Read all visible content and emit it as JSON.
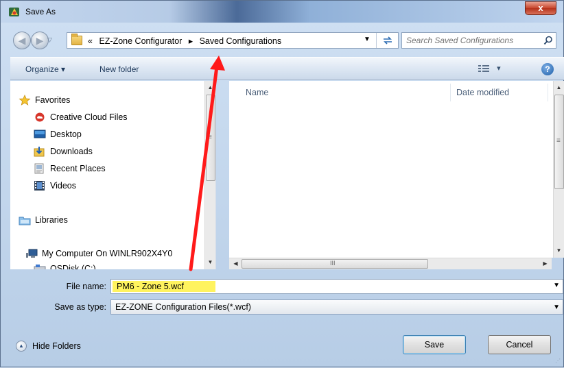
{
  "window": {
    "title": "Save As",
    "close_label": "x"
  },
  "nav": {
    "back_glyph": "◀",
    "forward_glyph": "▶",
    "address": {
      "prefix": "«",
      "segments": [
        "EZ-Zone Configurator",
        "Saved Configurations"
      ],
      "separator": "▸"
    },
    "search_placeholder": "Search Saved Configurations"
  },
  "toolbar": {
    "organize_label": "Organize ▾",
    "new_folder_label": "New folder",
    "view_label": "▾",
    "help_label": "?"
  },
  "sidebar": {
    "items": [
      {
        "label": "Favorites",
        "icon": "star-icon"
      },
      {
        "label": "Creative Cloud Files",
        "icon": "creative-cloud-icon"
      },
      {
        "label": "Desktop",
        "icon": "desktop-icon"
      },
      {
        "label": "Downloads",
        "icon": "downloads-icon"
      },
      {
        "label": "Recent Places",
        "icon": "recent-places-icon"
      },
      {
        "label": "Videos",
        "icon": "videos-icon"
      },
      {
        "label": "Libraries",
        "icon": "libraries-icon"
      },
      {
        "label": "My Computer On WINLR902X4Y0",
        "icon": "computer-icon"
      },
      {
        "label": "OSDisk (C:)",
        "icon": "disk-icon"
      }
    ]
  },
  "filelist": {
    "columns": [
      "Name",
      "Date modified"
    ],
    "scroll_grip": "III"
  },
  "form": {
    "filename_label": "File name:",
    "filename_value": "PM6 - Zone 5.wcf",
    "savetype_label": "Save as type:",
    "savetype_value": "EZ-ZONE Configuration Files(*.wcf)"
  },
  "footer": {
    "hide_folders_label": "Hide Folders",
    "save_label": "Save",
    "cancel_label": "Cancel"
  },
  "colors": {
    "highlight": "#fff35e",
    "annotation_arrow": "#ff0000",
    "accent": "#3c7fb1"
  }
}
